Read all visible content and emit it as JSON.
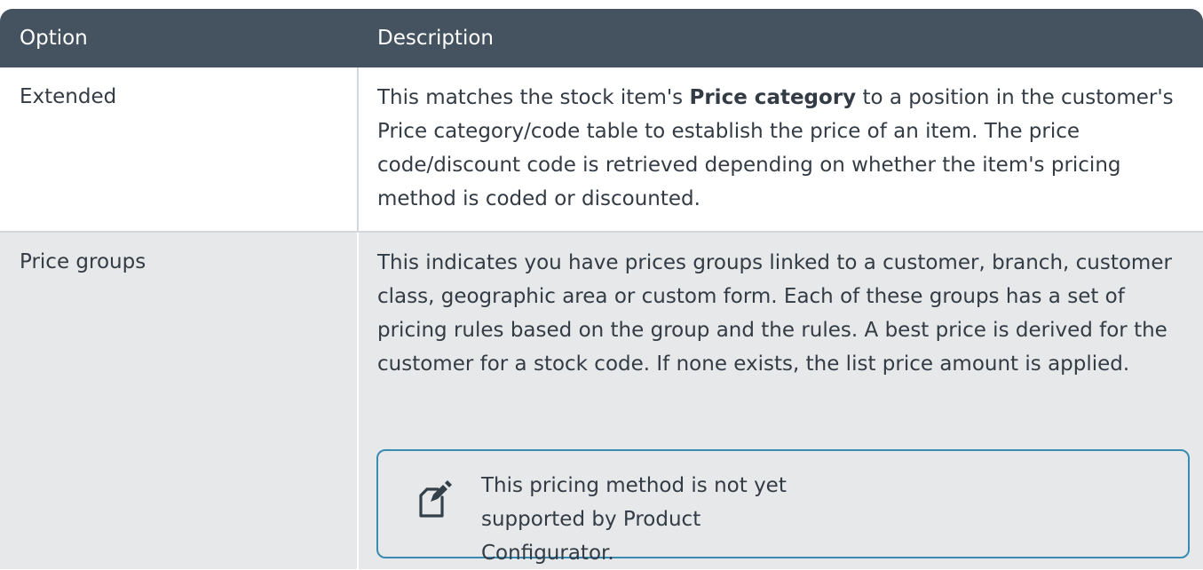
{
  "table": {
    "headers": {
      "option": "Option",
      "description": "Description"
    },
    "rows": [
      {
        "option": "Extended",
        "description_prefix": "This matches the stock item's ",
        "description_bold": "Price category",
        "description_suffix": " to a position in the customer's Price category/code table to establish the price of an item. The price code/discount code is retrieved depending on whether the item's pricing method is coded or discounted."
      },
      {
        "option": "Price groups",
        "description": "This indicates you have prices groups linked to a customer, branch, customer class, geographic area or custom form. Each of these groups has a set of pricing rules based on the group and the rules. A best price is derived for the customer for a stock code. If none exists, the list price amount is applied.",
        "note": {
          "icon": "note-pencil-icon",
          "text": "This pricing method is not yet supported by Product Configurator."
        }
      }
    ]
  },
  "colors": {
    "header_bg": "#44535f",
    "alt_row_bg": "#e6e8ea",
    "note_border": "#3a8bb2"
  }
}
